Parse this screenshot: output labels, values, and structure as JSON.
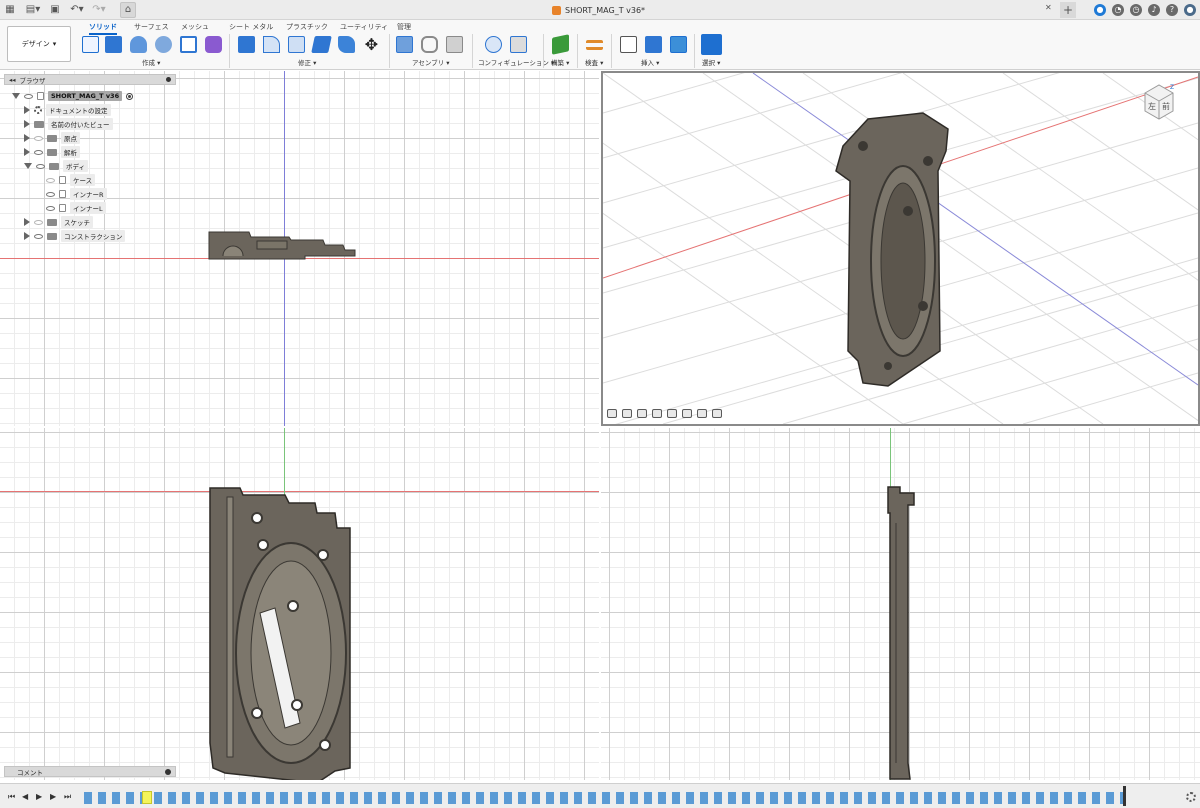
{
  "titlebar": {
    "document_title": "SHORT_MAG_T v36*"
  },
  "toolbar": {
    "workspace_label": "デザイン",
    "tabs": [
      "ソリッド",
      "サーフェス",
      "メッシュ",
      "シート メタル",
      "プラスチック",
      "ユーティリティ",
      "管理"
    ],
    "active_tab": "ソリッド",
    "groups": {
      "create": "作成",
      "modify": "修正",
      "assemble": "アセンブリ",
      "configure": "コンフィギュレーション",
      "construct": "構築",
      "inspect": "検査",
      "insert": "挿入",
      "select": "選択"
    }
  },
  "browser": {
    "title": "ブラウザ",
    "root": "SHORT_MAG_T v36",
    "items": [
      {
        "label": "ドキュメントの設定"
      },
      {
        "label": "名前の付いたビュー"
      },
      {
        "label": "原点"
      },
      {
        "label": "解析"
      },
      {
        "label": "ボディ"
      },
      {
        "label": "ケース"
      },
      {
        "label": "インナーR"
      },
      {
        "label": "インナーL"
      },
      {
        "label": "スケッチ"
      },
      {
        "label": "コンストラクション"
      }
    ]
  },
  "comment": {
    "label": "コメント"
  },
  "viewcube": {
    "face_left": "左",
    "face_front": "前",
    "axis_label": "Z"
  },
  "icons": {
    "accent": "#0a63c9",
    "timeline_feature": "#5b9bd5",
    "model_fill": "#6b655c"
  }
}
